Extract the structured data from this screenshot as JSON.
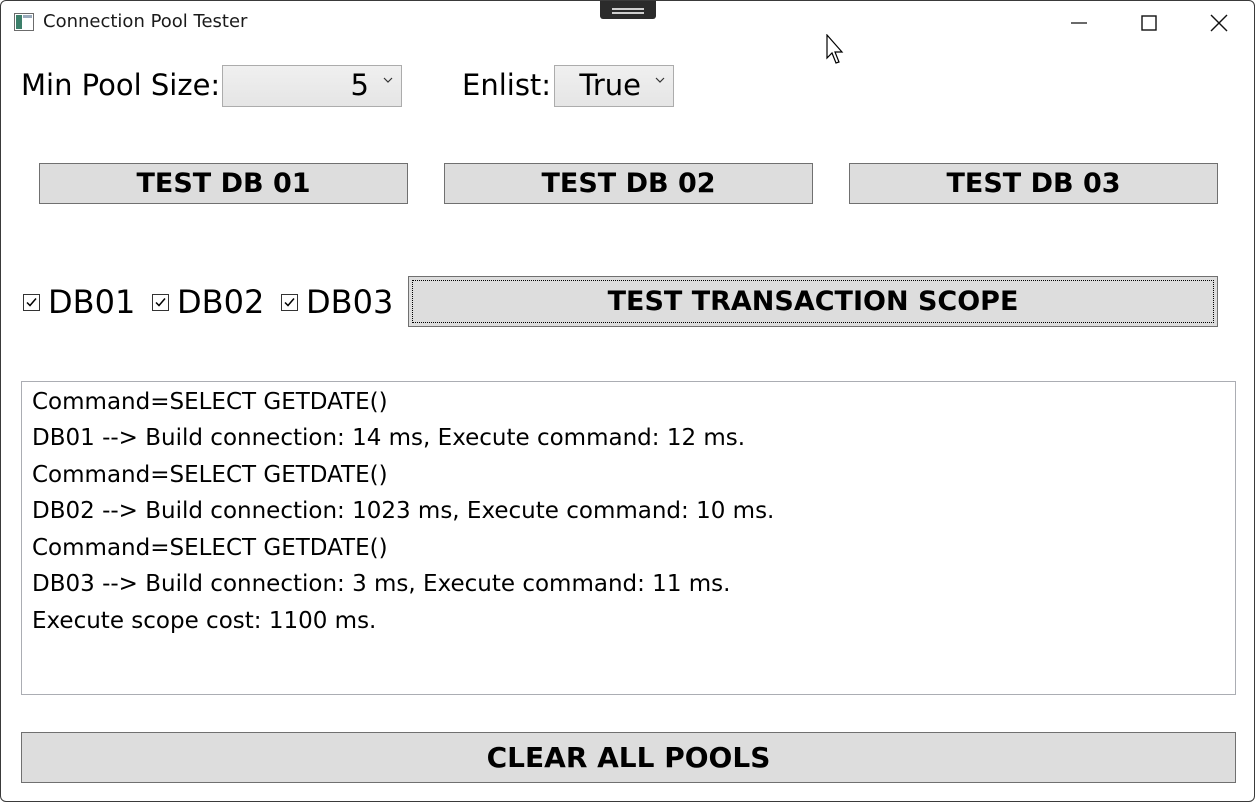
{
  "window": {
    "title": "Connection Pool Tester"
  },
  "settings": {
    "min_pool_label": "Min Pool Size:",
    "min_pool_value": "5",
    "enlist_label": "Enlist:",
    "enlist_value": "True"
  },
  "buttons": {
    "test_db_01": "TEST DB 01",
    "test_db_02": "TEST DB 02",
    "test_db_03": "TEST DB 03",
    "test_scope": "TEST TRANSACTION SCOPE",
    "clear_pools": "CLEAR ALL POOLS"
  },
  "checkboxes": [
    {
      "label": "DB01",
      "checked": true
    },
    {
      "label": "DB02",
      "checked": true
    },
    {
      "label": "DB03",
      "checked": true
    }
  ],
  "log": [
    "Command=SELECT GETDATE()",
    "DB01 --> Build connection: 14 ms, Execute command: 12 ms.",
    "Command=SELECT GETDATE()",
    "DB02 --> Build connection: 1023 ms, Execute command: 10 ms.",
    "Command=SELECT GETDATE()",
    "DB03 --> Build connection: 3 ms, Execute command: 11 ms.",
    "Execute scope cost: 1100 ms."
  ]
}
